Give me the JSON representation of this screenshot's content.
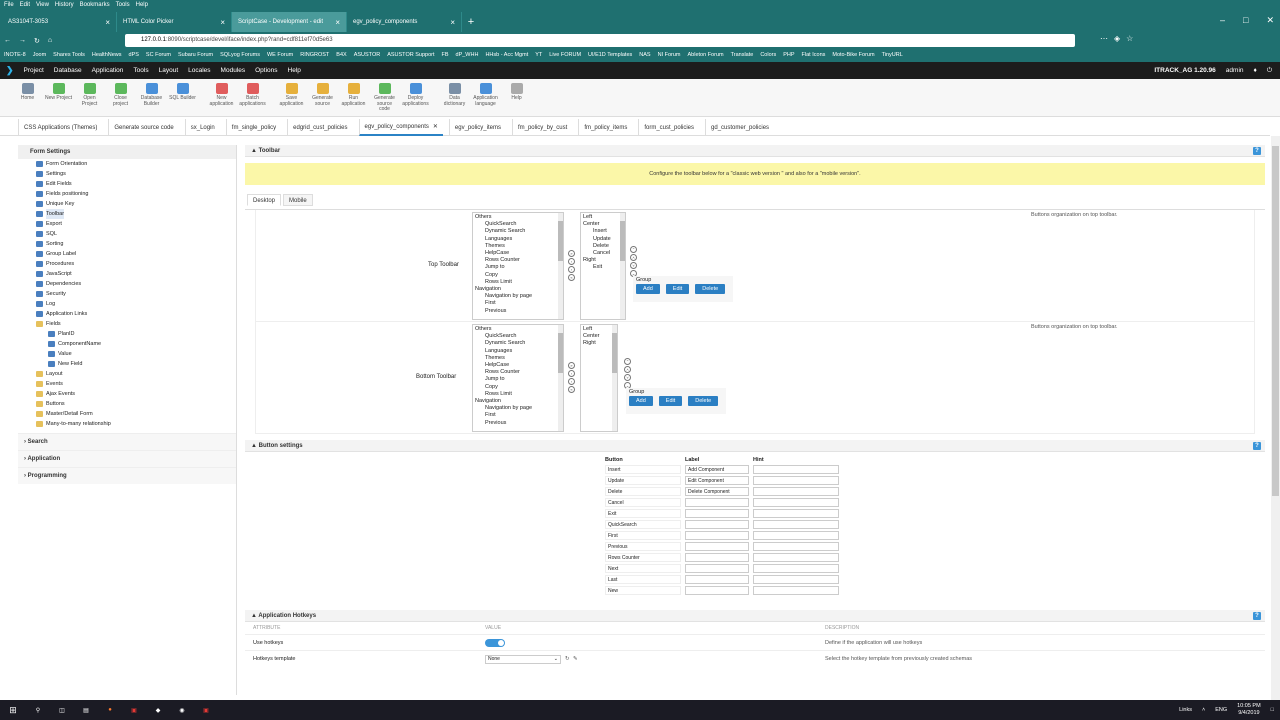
{
  "browser": {
    "menu": [
      "File",
      "Edit",
      "View",
      "History",
      "Bookmarks",
      "Tools",
      "Help"
    ],
    "tabs": [
      {
        "label": "AS3104T-3053",
        "active": false
      },
      {
        "label": "HTML Color Picker",
        "active": false
      },
      {
        "label": "ScriptCase - Development - edit",
        "active": true
      },
      {
        "label": "egv_policy_components",
        "active": false
      }
    ],
    "url_prefix": "127.0.0.1",
    "url_rest": ":8090/scriptcase/devel/iface/index.php?rand=cdf811ef70d5e63",
    "bookmarks": [
      "INOTE-8",
      "Joom",
      "Shares Tools",
      "HealthNews",
      "dPS",
      "SC Forum",
      "Subaru Forum",
      "SQLyog Forums",
      "WE Forum",
      "RINGROST",
      "B4X",
      "ASUSTOR",
      "ASUSTOR Support",
      "FB",
      "dP_WHH",
      "HHsb - Acc Mgmt",
      "YT",
      "Live FORUM",
      "UI/E1D Templates",
      "NAS",
      "NI Forum",
      "Ableton Forum",
      "Translate",
      "Colors",
      "PHP",
      "Flat Icons",
      "Moto-Bike Forum",
      "TinyURL"
    ]
  },
  "app": {
    "menu": [
      "Project",
      "Database",
      "Application",
      "Tools",
      "Layout",
      "Locales",
      "Modules",
      "Options",
      "Help"
    ],
    "project": "ITRACK_AG 1.20.96",
    "user": "admin",
    "toolbar": [
      {
        "label": "Home",
        "color": "#7a8fa6"
      },
      {
        "label": "New Project",
        "color": "#5cb85c"
      },
      {
        "label": "Open Project",
        "color": "#5cb85c"
      },
      {
        "label": "Close project",
        "color": "#5cb85c"
      },
      {
        "label": "Database Builder",
        "color": "#4a90d9"
      },
      {
        "label": "SQL Builder",
        "color": "#4a90d9"
      },
      {
        "label": "New application",
        "color": "#e05d5d"
      },
      {
        "label": "Batch applications",
        "color": "#e05d5d"
      },
      {
        "label": "Save application",
        "color": "#e6b03c"
      },
      {
        "label": "Generate source",
        "color": "#e6b03c"
      },
      {
        "label": "Run application",
        "color": "#e6b03c"
      },
      {
        "label": "Generate source code",
        "color": "#5cb85c"
      },
      {
        "label": "Deploy applications",
        "color": "#4a90d9"
      },
      {
        "label": "Data dictionary",
        "color": "#7a8fa6"
      },
      {
        "label": "Application language",
        "color": "#4a90d9"
      },
      {
        "label": "Help",
        "color": "#aaaaaa"
      }
    ],
    "doc_tabs": [
      {
        "label": "CSS Applications (Themes)",
        "active": false,
        "close": false
      },
      {
        "label": "Generate source code",
        "active": false,
        "close": false
      },
      {
        "label": "sx_Login",
        "active": false,
        "close": false
      },
      {
        "label": "fm_single_policy",
        "active": false,
        "close": false
      },
      {
        "label": "edgrid_cust_policies",
        "active": false,
        "close": false
      },
      {
        "label": "egv_policy_components",
        "active": true,
        "close": true
      },
      {
        "label": "egv_policy_items",
        "active": false,
        "close": false
      },
      {
        "label": "fm_policy_by_cust",
        "active": false,
        "close": false
      },
      {
        "label": "fm_policy_items",
        "active": false,
        "close": false
      },
      {
        "label": "form_cust_policies",
        "active": false,
        "close": false
      },
      {
        "label": "gd_customer_policies",
        "active": false,
        "close": false
      }
    ]
  },
  "sidebar": {
    "title": "Form Settings",
    "items": [
      {
        "label": "Form Orientation",
        "level": 1,
        "folder": false
      },
      {
        "label": "Settings",
        "level": 1,
        "folder": false
      },
      {
        "label": "Edit Fields",
        "level": 1,
        "folder": false
      },
      {
        "label": "Fields positioning",
        "level": 1,
        "folder": false
      },
      {
        "label": "Unique Key",
        "level": 1,
        "folder": false
      },
      {
        "label": "Toolbar",
        "level": 1,
        "folder": false,
        "active": true
      },
      {
        "label": "Export",
        "level": 1,
        "folder": false
      },
      {
        "label": "SQL",
        "level": 1,
        "folder": false
      },
      {
        "label": "Sorting",
        "level": 1,
        "folder": false
      },
      {
        "label": "Group Label",
        "level": 1,
        "folder": false
      },
      {
        "label": "Procedures",
        "level": 1,
        "folder": false
      },
      {
        "label": "JavaScript",
        "level": 1,
        "folder": false
      },
      {
        "label": "Dependencies",
        "level": 1,
        "folder": false
      },
      {
        "label": "Security",
        "level": 1,
        "folder": false
      },
      {
        "label": "Log",
        "level": 1,
        "folder": false
      },
      {
        "label": "Application Links",
        "level": 1,
        "folder": false
      },
      {
        "label": "Fields",
        "level": 1,
        "folder": true
      },
      {
        "label": "PlanID",
        "level": 2,
        "folder": false
      },
      {
        "label": "ComponentName",
        "level": 2,
        "folder": false
      },
      {
        "label": "Value",
        "level": 2,
        "folder": false
      },
      {
        "label": "New Field",
        "level": 2,
        "folder": false
      },
      {
        "label": "Layout",
        "level": 1,
        "folder": true
      },
      {
        "label": "Events",
        "level": 1,
        "folder": true
      },
      {
        "label": "Ajax Events",
        "level": 1,
        "folder": true
      },
      {
        "label": "Buttons",
        "level": 1,
        "folder": true
      },
      {
        "label": "Master/Detail Form",
        "level": 1,
        "folder": true
      },
      {
        "label": "Many-to-many relationship",
        "level": 1,
        "folder": true
      }
    ],
    "sections": [
      "Search",
      "Application",
      "Programming"
    ]
  },
  "toolbar_panel": {
    "title": "Toolbar",
    "notice": "Configure the toolbar below for a \"classic web version \" and also for a \"mobile version\".",
    "tabs": [
      "Desktop",
      "Mobile"
    ],
    "top_label": "Top Toolbar",
    "bottom_label": "Bottom Toolbar",
    "hint": "Buttons organization on top toolbar.",
    "hint2": "Buttons organization on top toolbar.",
    "available": [
      {
        "t": "Others",
        "lvl": 0
      },
      {
        "t": "QuickSearch",
        "lvl": 1
      },
      {
        "t": "Dynamic Search",
        "lvl": 1
      },
      {
        "t": "Languages",
        "lvl": 1
      },
      {
        "t": "Themes",
        "lvl": 1
      },
      {
        "t": "HelpCase",
        "lvl": 1
      },
      {
        "t": "Rows Counter",
        "lvl": 1
      },
      {
        "t": "Jump to",
        "lvl": 1
      },
      {
        "t": "Copy",
        "lvl": 1
      },
      {
        "t": "Rows Limit",
        "lvl": 1
      },
      {
        "t": "Navigation",
        "lvl": 0
      },
      {
        "t": "Navigation by page",
        "lvl": 1
      },
      {
        "t": "First",
        "lvl": 1
      },
      {
        "t": "Previous",
        "lvl": 1
      }
    ],
    "available_bottom": [
      {
        "t": "Others",
        "lvl": 0
      },
      {
        "t": "QuickSearch",
        "lvl": 1
      },
      {
        "t": "Dynamic Search",
        "lvl": 1
      },
      {
        "t": "Languages",
        "lvl": 1
      },
      {
        "t": "Themes",
        "lvl": 1
      },
      {
        "t": "HelpCase",
        "lvl": 1
      },
      {
        "t": "Rows Counter",
        "lvl": 1
      },
      {
        "t": "Jump to",
        "lvl": 1
      },
      {
        "t": "Copy",
        "lvl": 1
      },
      {
        "t": "Rows Limit",
        "lvl": 1
      },
      {
        "t": "Navigation",
        "lvl": 0
      },
      {
        "t": "Navigation by page",
        "lvl": 1
      },
      {
        "t": "First",
        "lvl": 1
      },
      {
        "t": "Previous",
        "lvl": 1
      }
    ],
    "selected_top": [
      {
        "t": "Left",
        "lvl": 0
      },
      {
        "t": "Center",
        "lvl": 0
      },
      {
        "t": "Insert",
        "lvl": 1
      },
      {
        "t": "Update",
        "lvl": 1
      },
      {
        "t": "Delete",
        "lvl": 1
      },
      {
        "t": "Cancel",
        "lvl": 1
      },
      {
        "t": "Right",
        "lvl": 0
      },
      {
        "t": "Exit",
        "lvl": 1
      }
    ],
    "selected_bottom": [
      {
        "t": "Left",
        "lvl": 0
      },
      {
        "t": "Center",
        "lvl": 0
      },
      {
        "t": "Right",
        "lvl": 0
      }
    ],
    "group_label": "Group",
    "group_label2": "Group",
    "btn_add": "Add",
    "btn_edit": "Edit",
    "btn_delete": "Delete"
  },
  "button_settings": {
    "title": "Button settings",
    "headers": [
      "Button",
      "Label",
      "Hint"
    ],
    "rows": [
      {
        "button": "Insert",
        "label": "Add Component",
        "hint": ""
      },
      {
        "button": "Update",
        "label": "Edit Component",
        "hint": ""
      },
      {
        "button": "Delete",
        "label": "Delete Component",
        "hint": ""
      },
      {
        "button": "Cancel",
        "label": "",
        "hint": ""
      },
      {
        "button": "Exit",
        "label": "",
        "hint": ""
      },
      {
        "button": "QuickSearch",
        "label": "",
        "hint": ""
      },
      {
        "button": "First",
        "label": "",
        "hint": ""
      },
      {
        "button": "Previous",
        "label": "",
        "hint": ""
      },
      {
        "button": "Rows Counter",
        "label": "",
        "hint": ""
      },
      {
        "button": "Next",
        "label": "",
        "hint": ""
      },
      {
        "button": "Last",
        "label": "",
        "hint": ""
      },
      {
        "button": "New",
        "label": "",
        "hint": ""
      }
    ]
  },
  "hotkeys": {
    "title": "Application Hotkeys",
    "col_attribute": "ATTRIBUTE",
    "col_value": "VALUE",
    "col_description": "DESCRIPTION",
    "use_label": "Use hotkeys",
    "use_desc": "Define if the application will use hotkeys",
    "template_label": "Hotkeys template",
    "template_value": "None",
    "template_desc": "Select the hotkey template from previously created schemas"
  },
  "taskbar": {
    "links": "Links",
    "lang": "ENG",
    "time": "10:05 PM",
    "date": "9/4/2019"
  }
}
